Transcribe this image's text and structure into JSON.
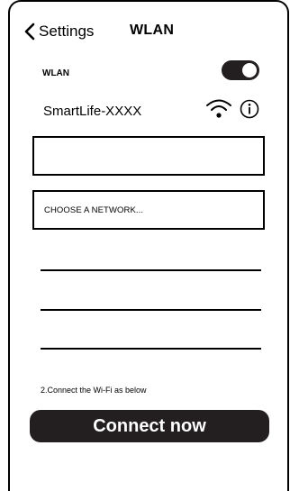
{
  "nav": {
    "back_label": "Settings",
    "title": "WLAN",
    "back_icon": "chevron-left-icon"
  },
  "wlan": {
    "label": "WLAN",
    "toggle_on": true
  },
  "network": {
    "name": "SmartLife-XXXX",
    "wifi_icon": "wifi-icon",
    "info_icon": "info-icon"
  },
  "fields": {
    "empty_box_value": "",
    "choose_network": "CHOOSE A NETWORK..."
  },
  "hint": "2.Connect the Wi-Fi as below",
  "connect_button": "Connect now",
  "colors": {
    "primary": "#231f20",
    "background": "#ffffff",
    "text": "#000000"
  }
}
